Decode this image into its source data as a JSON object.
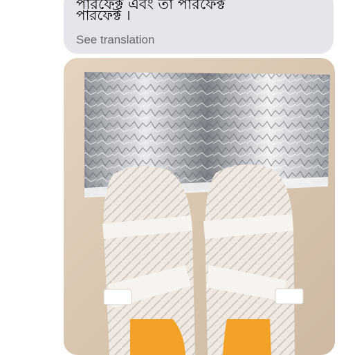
{
  "message": {
    "clipped_top_text": "পারফেক্ট এবং তা পারফেক্ট",
    "text": "পারফেক্ট ।",
    "see_translation": "See translation"
  },
  "photo": {
    "subject": "white-sandals-on-silver-foil-bag",
    "colors": {
      "floor": "#d8c7b2",
      "foil": "#b9bcc2",
      "sandal": "#efe9e1",
      "insole": "#f2a227"
    }
  }
}
